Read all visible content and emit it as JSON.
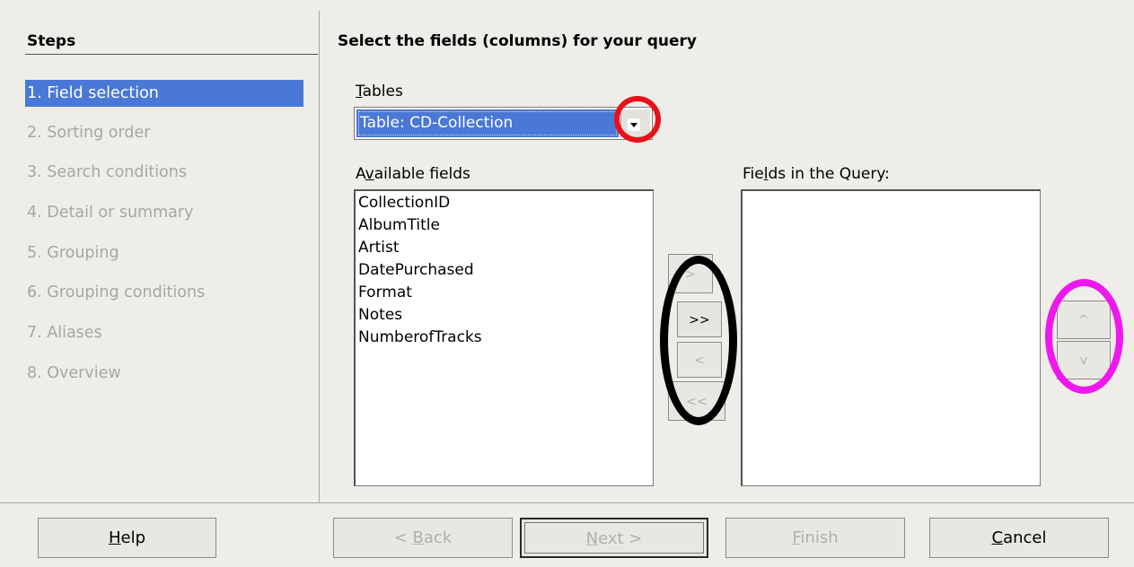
{
  "steps_panel": {
    "title": "Steps",
    "items": [
      {
        "label": "1. Field selection",
        "selected": true
      },
      {
        "label": "2. Sorting order"
      },
      {
        "label": "3. Search conditions"
      },
      {
        "label": "4. Detail or summary"
      },
      {
        "label": "5. Grouping"
      },
      {
        "label": "6. Grouping conditions"
      },
      {
        "label": "7. Aliases"
      },
      {
        "label": "8. Overview"
      }
    ]
  },
  "content": {
    "title": "Select the fields (columns) for your query",
    "tables_label_mn": "T",
    "tables_label_rest": "ables",
    "tables_value": "Table: CD-Collection",
    "available_label_a": "A",
    "available_label_mn": "v",
    "available_label_b": "ailable fields",
    "available_fields": [
      "CollectionID",
      "AlbumTitle",
      "Artist",
      "DatePurchased",
      "Format",
      "Notes",
      "NumberofTracks"
    ],
    "query_label_a": "Fie",
    "query_label_mn": "l",
    "query_label_b": "ds in the Query:",
    "query_fields": []
  },
  "move_buttons": {
    "add_one": ">",
    "add_all": ">>",
    "remove_one": "<",
    "remove_all": "<<"
  },
  "order_buttons": {
    "up": "^",
    "down": "v"
  },
  "footer": {
    "help_mn": "H",
    "help_rest": "elp",
    "back_pre": "< ",
    "back_mn": "B",
    "back_rest": "ack",
    "next_mn": "N",
    "next_rest": "ext >",
    "finish_mn": "F",
    "finish_rest": "inish",
    "cancel_mn": "C",
    "cancel_rest": "ancel"
  },
  "colors": {
    "selection": "#4a78d6",
    "annotation_red": "#e8111a",
    "annotation_black": "#000000",
    "annotation_magenta": "#ee18ee"
  }
}
